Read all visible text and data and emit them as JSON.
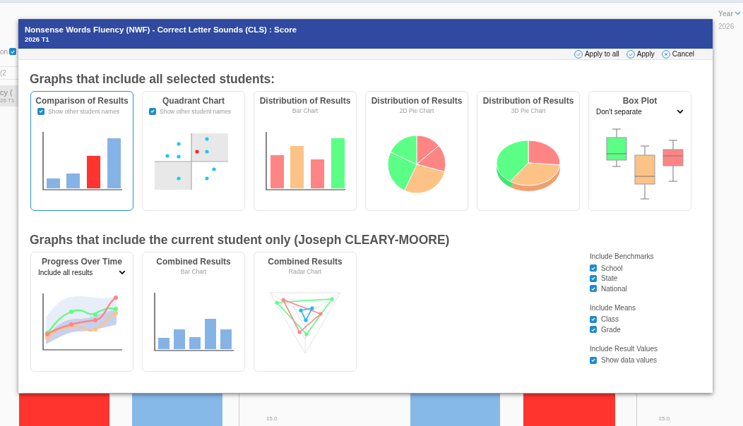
{
  "background": {
    "filter": {
      "label": "on",
      "checked": true
    },
    "range": "(2",
    "column_header": {
      "title": "cy (",
      "subtitle": "26 T1"
    },
    "year_label": "Year",
    "year_value": "2026",
    "axis_labels": [
      "15.0",
      "15.0"
    ]
  },
  "dialog": {
    "title": "Nonsense Words Fluency (NWF) - Correct Letter Sounds (CLS) : Score",
    "subtitle": "2026 T1",
    "actions": [
      {
        "label": "Apply to all",
        "kind": "confirm"
      },
      {
        "label": "Apply",
        "kind": "confirm"
      },
      {
        "label": "Cancel",
        "kind": "cancel"
      }
    ]
  },
  "sections": [
    {
      "heading": "Graphs that include all selected students:",
      "cards": [
        {
          "kind": "comparison",
          "title": "Comparison of Results",
          "selected": true,
          "option": {
            "kind": "checkbox",
            "label": "Show other student names",
            "checked": true
          }
        },
        {
          "kind": "quadrant",
          "title": "Quadrant Chart",
          "selected": false,
          "option": {
            "kind": "checkbox",
            "label": "Show other student names",
            "checked": true
          }
        },
        {
          "kind": "bars",
          "title": "Distribution of Results",
          "subtitle": "Bar Chart",
          "selected": false
        },
        {
          "kind": "pie2d",
          "title": "Distribution of Results",
          "subtitle": "2D Pie Chart",
          "selected": false
        },
        {
          "kind": "pie3d",
          "title": "Distribution of Results",
          "subtitle": "3D Pie Chart",
          "selected": false
        },
        {
          "kind": "boxplot",
          "title": "Box Plot",
          "selected": false,
          "option": {
            "kind": "dropdown",
            "value": "Don't separate"
          }
        }
      ]
    },
    {
      "heading": "Graphs that include the current student only (Joseph CLEARY-MOORE)",
      "cards": [
        {
          "kind": "progress",
          "title": "Progress Over Time",
          "selected": false,
          "option": {
            "kind": "dropdown",
            "value": "Include all results"
          }
        },
        {
          "kind": "combined",
          "title": "Combined Results",
          "subtitle": "Bar Chart",
          "selected": false
        },
        {
          "kind": "radar",
          "title": "Combined Results",
          "subtitle": "Radar Chart",
          "selected": false
        }
      ],
      "options": [
        {
          "heading": "Include Benchmarks",
          "items": [
            {
              "label": "School",
              "checked": true
            },
            {
              "label": "State",
              "checked": true
            },
            {
              "label": "National",
              "checked": true
            }
          ]
        },
        {
          "heading": "Include Means",
          "items": [
            {
              "label": "Class",
              "checked": true
            },
            {
              "label": "Grade",
              "checked": true
            }
          ]
        },
        {
          "heading": "Include Result Values",
          "items": [
            {
              "label": "Show data values",
              "checked": true
            }
          ]
        }
      ]
    }
  ]
}
